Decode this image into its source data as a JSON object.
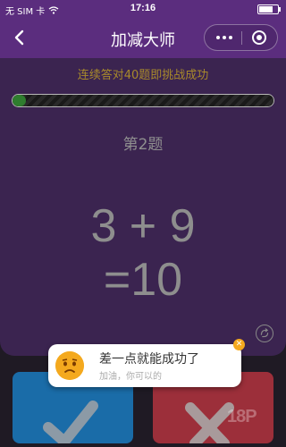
{
  "status": {
    "carrier": "无 SIM 卡",
    "time": "17:16"
  },
  "nav": {
    "title": "加减大师",
    "back_icon": "back-chevron-icon",
    "more_icon": "more-dots-icon",
    "close_icon": "target-close-icon"
  },
  "game": {
    "goal": "连续答对40题即挑战成功",
    "progress": 0.05,
    "question_number": "第2题",
    "expression": "3 + 9",
    "result": "=10"
  },
  "buttons": {
    "correct_icon": "check-icon",
    "wrong_icon": "cross-icon"
  },
  "toast": {
    "message": "差一点就能成功了",
    "sub": "加油，你可以的"
  },
  "colors": {
    "primary": "#5b2d7e",
    "card": "#3b2450",
    "correct": "#1a6ca8",
    "wrong": "#9c2f3a",
    "accent": "#f4a91e"
  }
}
